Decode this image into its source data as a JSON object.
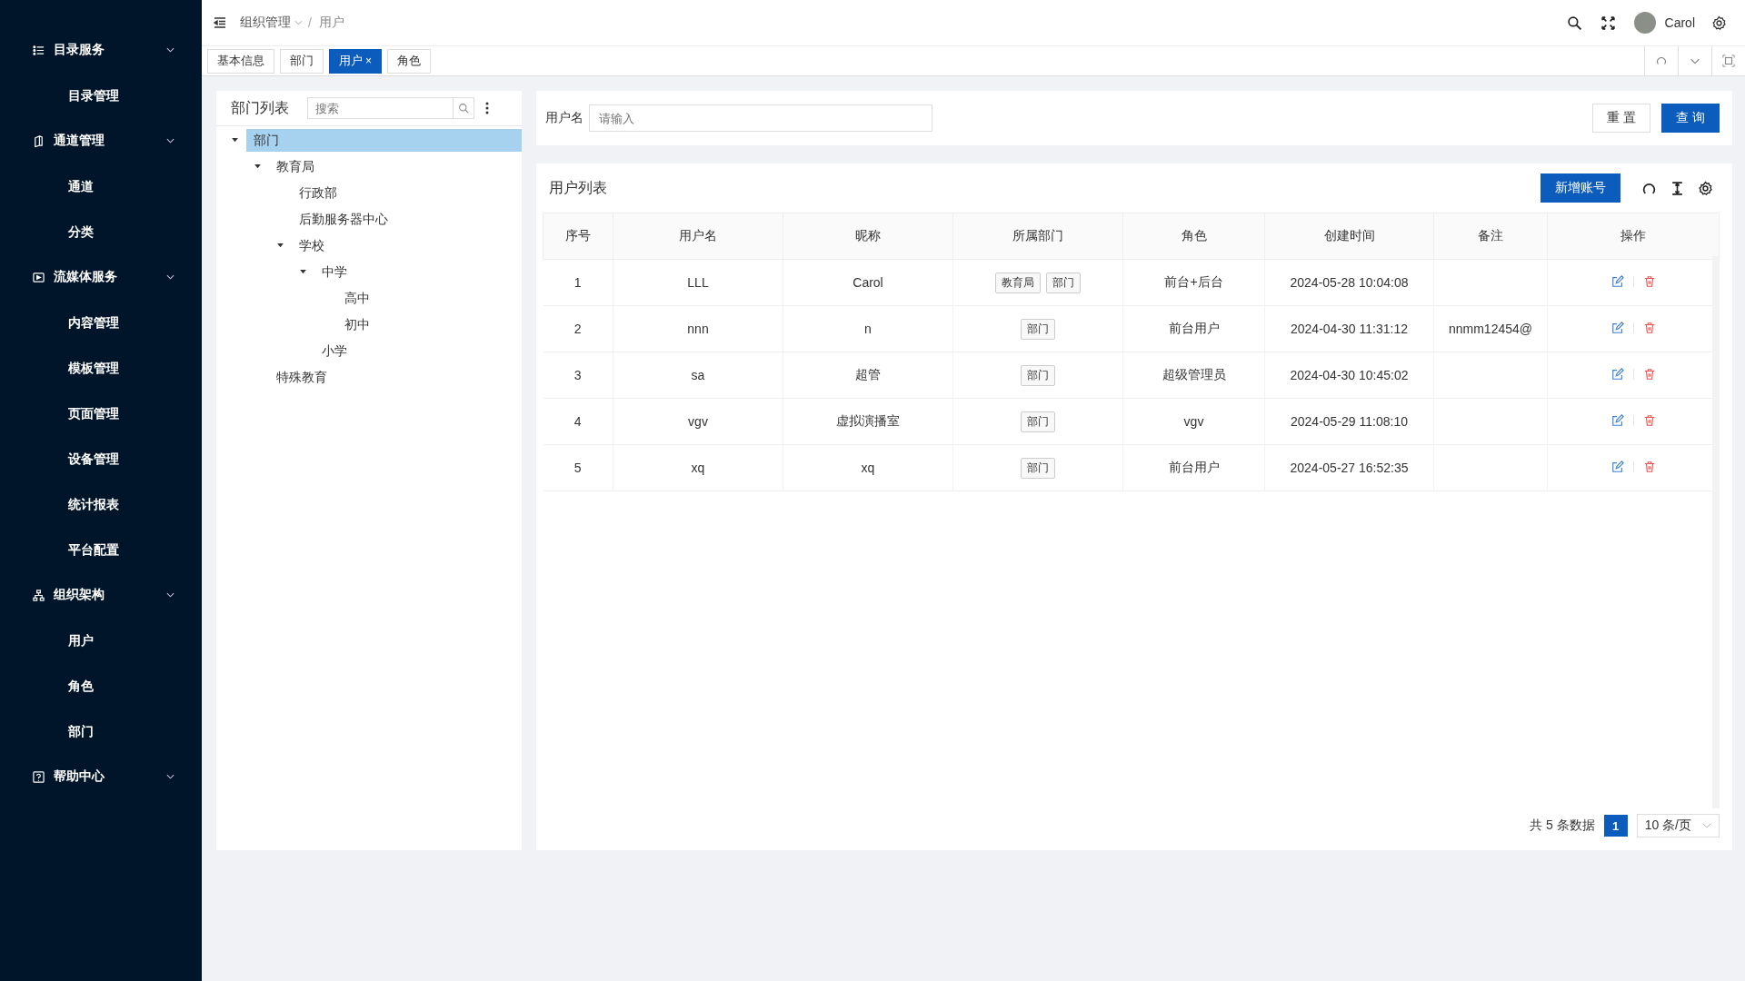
{
  "sidebar": {
    "groups": [
      {
        "label": "目录服务",
        "expanded": true,
        "items": [
          "目录管理"
        ]
      },
      {
        "label": "通道管理",
        "expanded": true,
        "items": [
          "通道",
          "分类"
        ]
      },
      {
        "label": "流媒体服务",
        "expanded": true,
        "items": [
          "内容管理",
          "模板管理",
          "页面管理",
          "设备管理",
          "统计报表",
          "平台配置"
        ]
      },
      {
        "label": "组织架构",
        "expanded": true,
        "items": [
          "用户",
          "角色",
          "部门"
        ]
      },
      {
        "label": "帮助中心",
        "expanded": true
      }
    ]
  },
  "header": {
    "breadcrumb": [
      "组织管理",
      "用户"
    ],
    "separator": "/",
    "user": "Carol"
  },
  "tabs": [
    {
      "label": "基本信息",
      "selected": false
    },
    {
      "label": "部门",
      "selected": false
    },
    {
      "label": "用户",
      "selected": true,
      "close": "×"
    },
    {
      "label": "角色",
      "selected": false
    }
  ],
  "dept_panel": {
    "title": "部门列表",
    "search": {
      "placeholder": "搜索"
    },
    "tree": [
      {
        "label": "部门",
        "selected": true,
        "expanded": true,
        "children": [
          {
            "label": "教育局",
            "selected": false,
            "expanded": true,
            "children": [
              {
                "label": "行政部",
                "selected": false
              },
              {
                "label": "后勤服务器中心",
                "selected": false
              },
              {
                "label": "学校",
                "selected": false,
                "expanded": true,
                "children": [
                  {
                    "label": "中学",
                    "selected": false,
                    "expanded": true,
                    "children": [
                      {
                        "label": "高中",
                        "selected": false
                      },
                      {
                        "label": "初中",
                        "selected": false
                      }
                    ]
                  },
                  {
                    "label": "小学",
                    "selected": false
                  }
                ]
              }
            ]
          },
          {
            "label": "特殊教育",
            "selected": false
          }
        ]
      }
    ]
  },
  "filter": {
    "label": "用户名",
    "placeholder": "请输入",
    "buttons": [
      "重 置",
      "查 询"
    ]
  },
  "user_table": {
    "title": "用户列表",
    "add_button": "新增账号",
    "columns": [
      "序号",
      "用户名",
      "昵称",
      "所属部门",
      "角色",
      "创建时间",
      "备注",
      "操作"
    ],
    "rows": [
      {
        "no": "1",
        "username": "LLL",
        "nickname": "Carol",
        "depts": [
          "教育局",
          "部门"
        ],
        "role": "前台+后台",
        "created": "2024-05-28 10:04:08"
      },
      {
        "no": "2",
        "username": "nnn",
        "nickname": "n",
        "depts": [
          "部门"
        ],
        "role": "前台用户",
        "created": "2024-04-30 11:31:12",
        "note": "nnmm12454@"
      },
      {
        "no": "3",
        "username": "sa",
        "nickname": "超管",
        "depts": [
          "部门"
        ],
        "role": "超级管理员",
        "created": "2024-04-30 10:45:02"
      },
      {
        "no": "4",
        "username": "vgv",
        "nickname": "虚拟演播室",
        "depts": [
          "部门"
        ],
        "role": "vgv",
        "created": "2024-05-29 11:08:10"
      },
      {
        "no": "5",
        "username": "xq",
        "nickname": "xq",
        "depts": [
          "部门"
        ],
        "role": "前台用户",
        "created": "2024-05-27 16:52:35"
      }
    ]
  },
  "pagination": {
    "total": "共 5 条数据",
    "pages": [
      {
        "label": "1",
        "selected": true
      }
    ],
    "page_size": "10 条/页"
  }
}
